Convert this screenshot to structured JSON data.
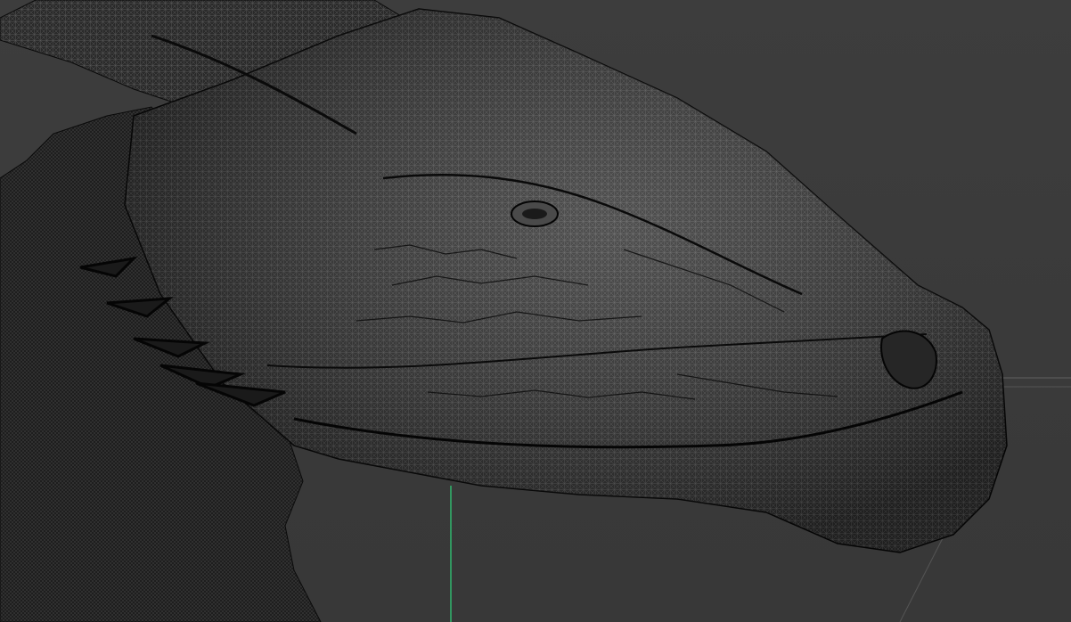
{
  "viewport": {
    "view": "perspective",
    "shading_mode": "wireframe",
    "subject": "dragon-head-sculpt"
  },
  "colors": {
    "background": "#3a3a3a",
    "mesh_fill": "#2e2e2e",
    "mesh_wire": "#0a0a0a",
    "mesh_highlight": "#8c8c8c",
    "grid_line": "#5a5a5a",
    "y_axis": "#2fbf71"
  }
}
